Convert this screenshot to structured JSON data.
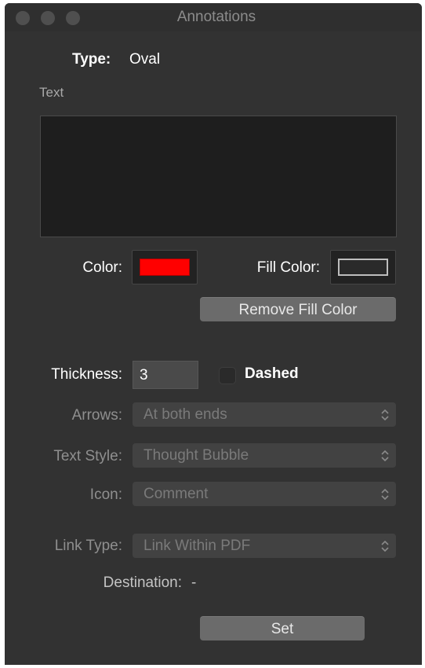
{
  "window": {
    "title": "Annotations"
  },
  "type_row": {
    "label": "Type:",
    "value": "Oval"
  },
  "text_section": {
    "label": "Text",
    "value": ""
  },
  "colors": {
    "color_label": "Color:",
    "color_value": "#ff0000",
    "fill_label": "Fill Color:",
    "fill_value": "none",
    "remove_fill_label": "Remove Fill Color"
  },
  "thickness": {
    "label": "Thickness:",
    "value": "3"
  },
  "dashed": {
    "label": "Dashed",
    "checked": false
  },
  "arrows": {
    "label": "Arrows:",
    "value": "At both ends"
  },
  "text_style": {
    "label": "Text Style:",
    "value": "Thought Bubble"
  },
  "icon": {
    "label": "Icon:",
    "value": "Comment"
  },
  "link_type": {
    "label": "Link Type:",
    "value": "Link Within PDF"
  },
  "destination": {
    "label": "Destination:",
    "value": "-"
  },
  "set_button": {
    "label": "Set"
  },
  "icons": {
    "window_controls": [
      "close-icon",
      "minimize-icon",
      "zoom-icon"
    ],
    "popup_indicator": "chevron-up-down-icon"
  }
}
